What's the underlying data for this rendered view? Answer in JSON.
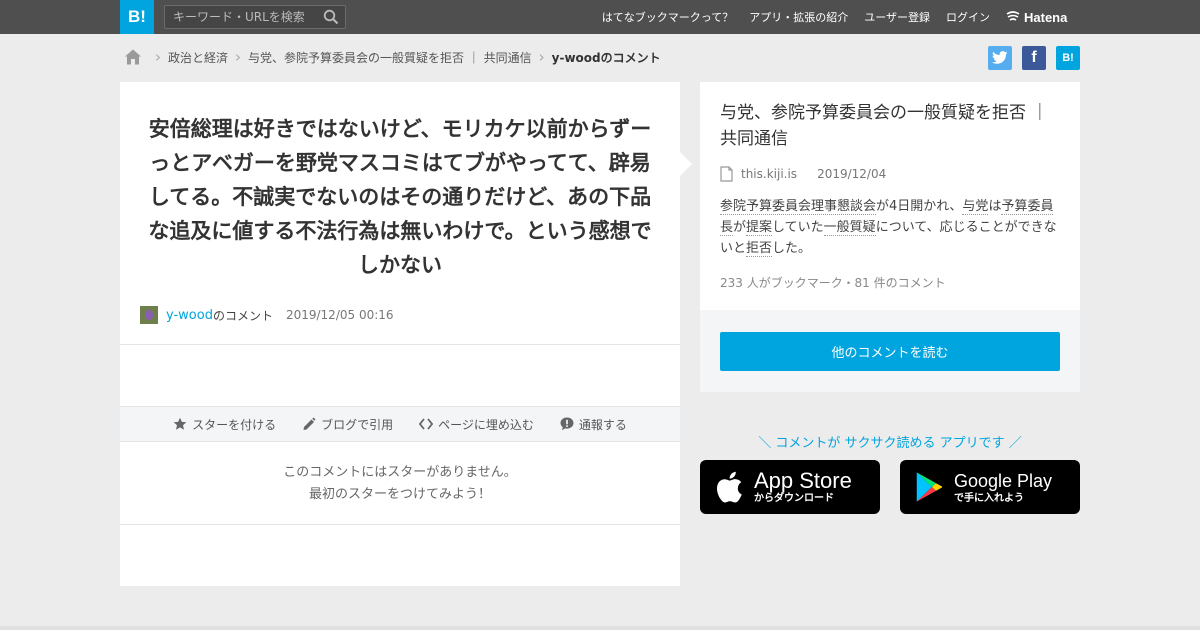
{
  "header": {
    "logo": "B!",
    "search_placeholder": "キーワード・URLを検索",
    "nav": [
      "はてなブックマークって？",
      "アプリ・拡張の紹介",
      "ユーザー登録",
      "ログイン"
    ],
    "brand": "Hatena",
    "bg_color": "#4f4f4f",
    "accent_color": "#00a4de"
  },
  "breadcrumb": {
    "items": [
      "政治と経済",
      "与党、参院予算委員会の一般質疑を拒否 ｜ 共同通信"
    ],
    "current": "y-woodのコメント"
  },
  "share": {
    "twitter_glyph": "🐦",
    "facebook_glyph": "f",
    "hatena_glyph": "B!"
  },
  "comment": {
    "text": "安倍総理は好きではないけど、モリカケ以前からずーっとアベガーを野党マスコミはてブがやってて、辟易してる。不誠実でないのはその通りだけど、あの下品な追及に値する不法行為は無いわけで。という感想でしかない",
    "author": "y-wood",
    "author_suffix": "のコメント",
    "date": "2019/12/05 00:16"
  },
  "actions": [
    {
      "icon": "star-icon",
      "label": "スターを付ける"
    },
    {
      "icon": "pencil-icon",
      "label": "ブログで引用"
    },
    {
      "icon": "code-icon",
      "label": "ページに埋め込む"
    },
    {
      "icon": "alert-icon",
      "label": "通報する"
    }
  ],
  "no_stars": {
    "line1": "このコメントにはスターがありません。",
    "line2": "最初のスターをつけてみよう！"
  },
  "entry": {
    "title": "与党、参院予算委員会の一般質疑を拒否 ｜ 共同通信",
    "domain": "this.kiji.is",
    "date": "2019/12/04",
    "summary": [
      {
        "text": "参院予算委員会理事懇談会",
        "kw": true
      },
      {
        "text": "が4日開かれ、",
        "kw": false
      },
      {
        "text": "与党",
        "kw": true
      },
      {
        "text": "は",
        "kw": false
      },
      {
        "text": "予算委員長",
        "kw": true
      },
      {
        "text": "が",
        "kw": false
      },
      {
        "text": "提案",
        "kw": true
      },
      {
        "text": "していた",
        "kw": false
      },
      {
        "text": "一般質疑",
        "kw": true
      },
      {
        "text": "について、応じることができないと",
        "kw": false
      },
      {
        "text": "拒否",
        "kw": true
      },
      {
        "text": "した。",
        "kw": false
      }
    ],
    "stats": "233 人がブックマーク・81 件のコメント",
    "read_more": "他のコメントを読む"
  },
  "promo": {
    "tagline": "＼ コメントが サクサク読める アプリです ／",
    "apple_main": "App Store",
    "apple_sub": "からダウンロード",
    "google_main": "Google Play",
    "google_sub": "で手に入れよう"
  }
}
